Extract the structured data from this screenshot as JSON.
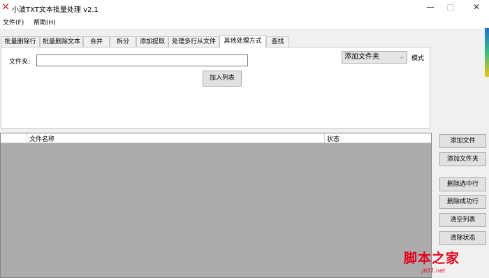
{
  "window": {
    "title": "小波TXT文本批量处理 v2.1",
    "app_icon_glyph": "⛌",
    "minimize_glyph": "—",
    "maximize_glyph": "□",
    "close_glyph": "✕"
  },
  "menubar": {
    "items": [
      "文件(F)",
      "帮助(H)"
    ]
  },
  "tabs": {
    "items": [
      "批量删除行",
      "批量删除文本",
      "合并",
      "拆分",
      "添加提取",
      "处理多行从文件",
      "其他处理方式",
      "查找"
    ],
    "active_index": 6
  },
  "panel": {
    "folder_label": "文件夹:",
    "folder_value": "",
    "add_to_list_button": "加入列表",
    "mode_select_value": "添加文件夹",
    "mode_label": "模式"
  },
  "list": {
    "columns": [
      "",
      "文件名称",
      "状态"
    ],
    "rows": []
  },
  "side_buttons": [
    "添加文件",
    "添加文件夹",
    "删除选中行",
    "删除成功行",
    "清空列表",
    "清除状态"
  ],
  "watermark": {
    "main": "脚本之家",
    "sub": "jb51.net"
  },
  "colors": {
    "list_background": "#ababab",
    "watermark_red": "#e8001c"
  }
}
